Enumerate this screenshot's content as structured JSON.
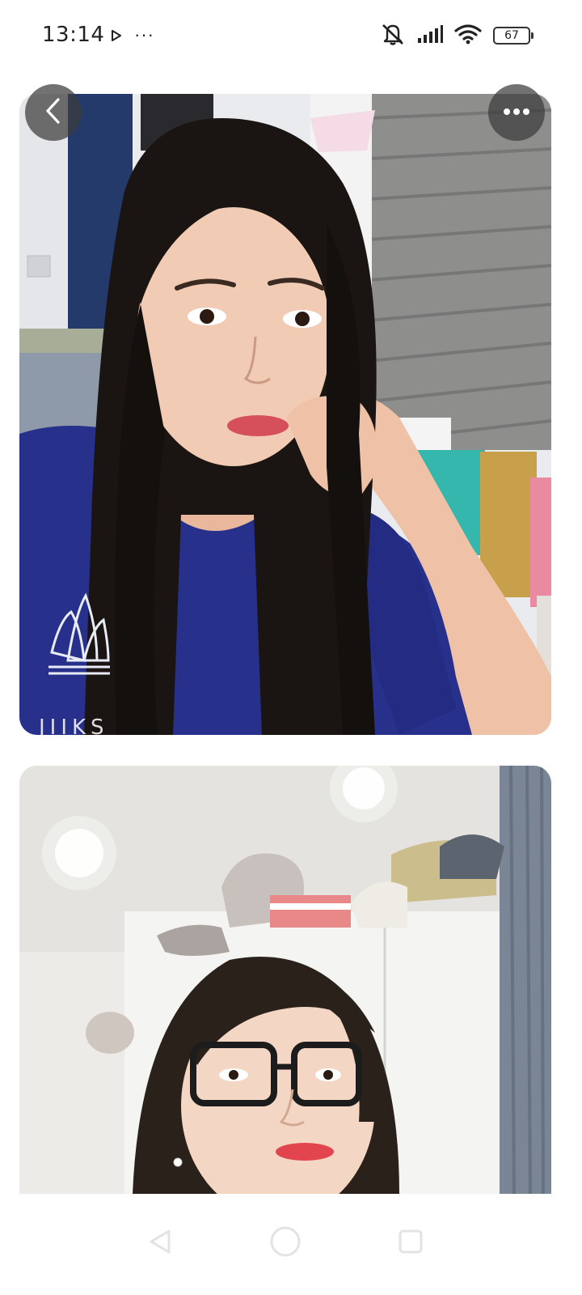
{
  "status_bar": {
    "time": "13:14",
    "more_indicator": "···",
    "battery_level": "67",
    "icons": [
      "play-notification-icon",
      "mute-icon",
      "signal-icon",
      "wifi-icon",
      "battery-icon"
    ]
  },
  "viewer": {
    "photo_1_caption_fragment": "JIIKS",
    "controls": {
      "back": "back-arrow-icon",
      "more": "more-options-icon"
    }
  },
  "colors": {
    "overlay_button": "#3c3c3c",
    "shirt": "#27308a",
    "background": "#ffffff"
  },
  "nav_bar": {
    "icons": [
      "nav-back-icon",
      "nav-home-icon",
      "nav-recents-icon"
    ]
  }
}
